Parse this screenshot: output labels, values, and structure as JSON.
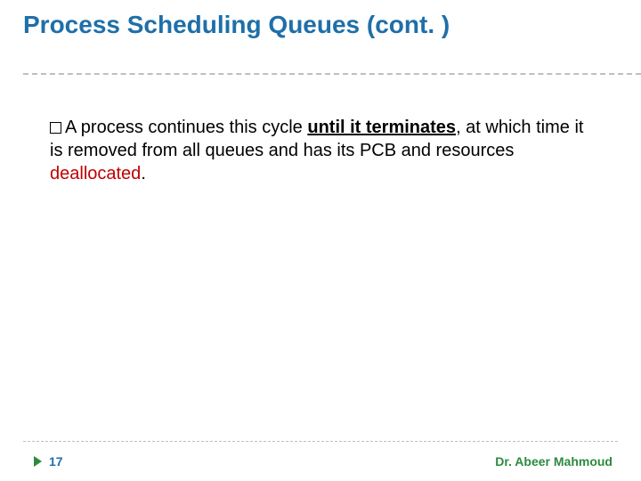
{
  "title": "Process Scheduling Queues (cont. )",
  "body": {
    "pre": "A process continues this cycle ",
    "emph": "until it terminates",
    "mid": ", at which time it is removed from all queues and has its PCB and resources ",
    "dealloc": "deallocated",
    "end": "."
  },
  "page_number": "17",
  "author": "Dr. Abeer Mahmoud"
}
